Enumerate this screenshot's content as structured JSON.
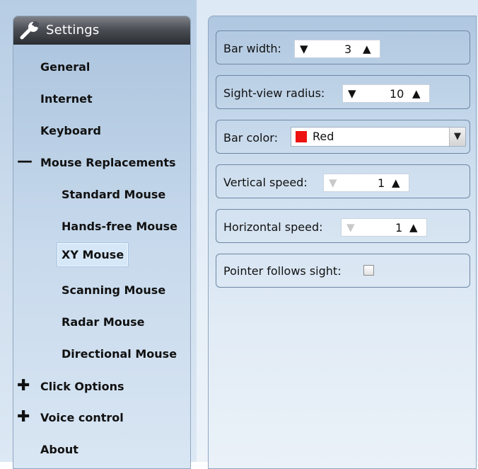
{
  "sidebar": {
    "title": "Settings",
    "icon": "wrench-icon",
    "items": [
      {
        "label": "General",
        "level": 0
      },
      {
        "label": "Internet",
        "level": 0
      },
      {
        "label": "Keyboard",
        "level": 0
      },
      {
        "label": "Mouse Replacements",
        "level": 0,
        "expander": "—",
        "expanded": true
      },
      {
        "label": "Standard Mouse",
        "level": 1
      },
      {
        "label": "Hands-free Mouse",
        "level": 1
      },
      {
        "label": "XY Mouse",
        "level": 1,
        "selected": true
      },
      {
        "label": "Scanning Mouse",
        "level": 1
      },
      {
        "label": "Radar Mouse",
        "level": 1
      },
      {
        "label": "Directional Mouse",
        "level": 1
      },
      {
        "label": "Click Options",
        "level": 0,
        "expander": "✚",
        "expanded": false
      },
      {
        "label": "Voice control",
        "level": 0,
        "expander": "✚",
        "expanded": false
      },
      {
        "label": "About",
        "level": 0
      }
    ]
  },
  "settings": {
    "bar_width": {
      "label": "Bar width:",
      "value": "3"
    },
    "sight_view_radius": {
      "label": "Sight-view radius:",
      "value": "10"
    },
    "bar_color": {
      "label": "Bar color:",
      "value": "Red",
      "swatch_color": "#ee1111"
    },
    "vertical_speed": {
      "label": "Vertical speed:",
      "value": "1",
      "decrement_disabled": true
    },
    "horizontal_speed": {
      "label": "Horizontal speed:",
      "value": "1",
      "decrement_disabled": true
    },
    "pointer_follows_sight": {
      "label": "Pointer follows sight:",
      "checked": false
    }
  },
  "glyphs": {
    "down": "▼",
    "up": "▲"
  }
}
